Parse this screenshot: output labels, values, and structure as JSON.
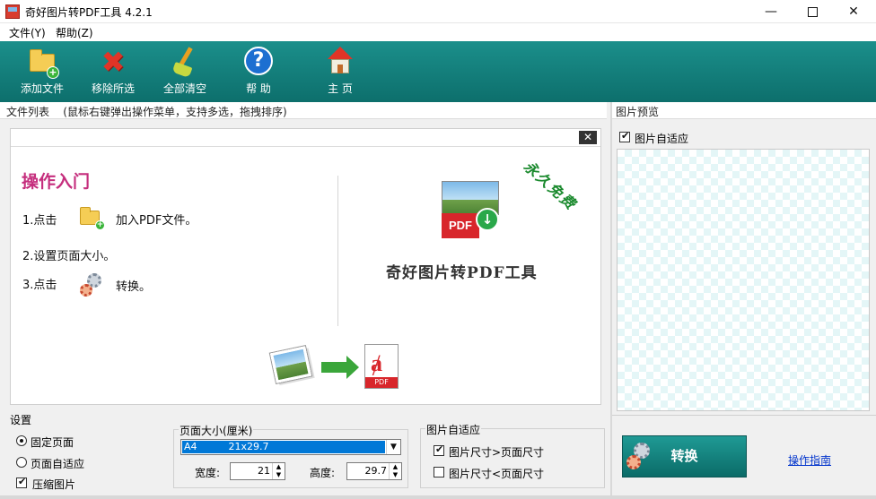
{
  "window": {
    "title": "奇好图片转PDF工具 4.2.1",
    "min_glyph": "—",
    "close_glyph": "✕"
  },
  "menu": {
    "file": "文件(Y)",
    "help": "帮助(Z)"
  },
  "toolbar": {
    "add_file": "添加文件",
    "remove_selected": "移除所选",
    "clear_all": "全部清空",
    "help": "帮 助",
    "home": "主 页",
    "help_glyph": "?",
    "remove_glyph": "✖"
  },
  "file_list": {
    "header": "文件列表    (鼠标右键弹出操作菜单，支持多选，拖拽排序)"
  },
  "intro": {
    "close": "✕",
    "title": "操作入门",
    "step1_prefix": "1.点击",
    "step1_suffix": "加入PDF文件。",
    "step2": "2.设置页面大小。",
    "step3_prefix": "3.点击",
    "step3_suffix": "转换。",
    "brand": "奇好图片转PDF工具",
    "stamp": "永久免费",
    "pdf_label": "PDF",
    "pdf_tag": "PDF",
    "download_glyph": "↓"
  },
  "settings": {
    "group_label": "设置",
    "fixed_page": "固定页面",
    "fit_page": "页面自适应",
    "compress": "压缩图片",
    "page_size_label": "页面大小(厘米)",
    "page_size_value": "A4          21x29.7",
    "width_label": "宽度:",
    "width_value": "21",
    "height_label": "高度:",
    "height_value": "29.7",
    "fit_group_label": "图片自适应",
    "img_gt_page": "图片尺寸>页面尺寸",
    "img_lt_page": "图片尺寸<页面尺寸"
  },
  "preview": {
    "header": "图片预览",
    "fit_label": "图片自适应"
  },
  "actions": {
    "convert": "转换",
    "guide": "操作指南"
  },
  "colors": {
    "toolbar": "#128a86",
    "accent_title": "#c52e7d",
    "stamp": "#1b8a2e",
    "link": "#0033cc"
  }
}
